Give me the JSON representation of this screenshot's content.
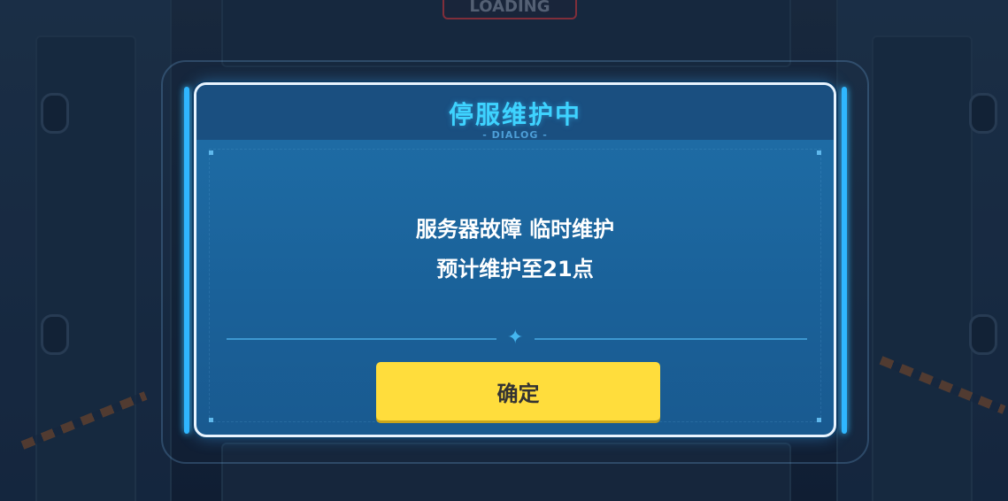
{
  "background": {
    "sign_text": "LOADING"
  },
  "dialog": {
    "title": "停服维护中",
    "subtitle": "- DIALOG -",
    "message_line1": "服务器故障 临时维护",
    "message_line2": "预计维护至21点",
    "confirm_label": "确定"
  },
  "colors": {
    "accent": "#3ed3ff",
    "button": "#ffdd3c",
    "panel": "#1a6199"
  },
  "icons": {
    "divider_ornament": "sparkle-icon",
    "background_alert": "exclamation-icon"
  }
}
